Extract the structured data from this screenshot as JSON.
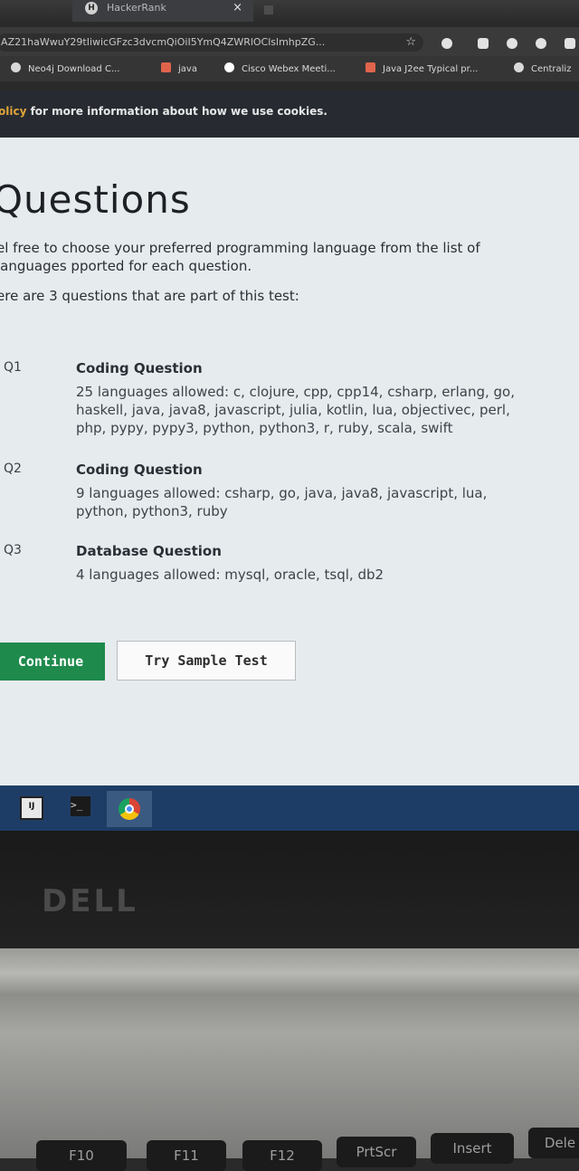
{
  "browser": {
    "tab_title": "HackerRank",
    "tab_favicon_letter": "H",
    "tab_close": "×",
    "url": "iAZ21haWwuY29tIiwicGFzc3dvcmQiOiI5YmQ4ZWRlOClslmhpZG...",
    "bookmarks": [
      {
        "label": "Neo4j Download C...",
        "icon": "neo4j-icon",
        "color": "#d9d9d9"
      },
      {
        "label": "java",
        "icon": "folder-icon",
        "color": "#e0644c"
      },
      {
        "label": "Cisco Webex Meeti...",
        "icon": "webex-icon",
        "color": "#ffffff"
      },
      {
        "label": "Java J2ee Typical pr...",
        "icon": "bookmark-icon",
        "color": "#e0644c"
      },
      {
        "label": "Centraliz",
        "icon": "globe-icon",
        "color": "#d9d9d9"
      }
    ]
  },
  "cookie_bar": {
    "link": "olicy",
    "text": " for more information about how we use cookies."
  },
  "page": {
    "heading": "Questions",
    "intro": "el free to choose your preferred programming language from the list of languages pported for each question.",
    "count_text": "ere are 3 questions that are part of this test:",
    "questions": [
      {
        "number": "Q1",
        "type": "Coding Question",
        "languages": "25 languages allowed: c, clojure, cpp, cpp14, csharp, erlang, go, haskell, java, java8, javascript, julia, kotlin, lua, objectivec, perl, php, pypy, pypy3, python, python3, r, ruby, scala, swift"
      },
      {
        "number": "Q2",
        "type": "Coding Question",
        "languages": "9 languages allowed: csharp, go, java, java8, javascript, lua, python, python3, ruby"
      },
      {
        "number": "Q3",
        "type": "Database Question",
        "languages": "4 languages allowed: mysql, oracle, tsql, db2"
      }
    ],
    "continue_label": "Continue",
    "sample_label": "Try Sample Test"
  },
  "taskbar": {
    "apps": [
      "intellij-icon",
      "terminal-icon",
      "chrome-icon"
    ],
    "intellij_text": "IJ",
    "terminal_text": ">_"
  },
  "laptop": {
    "brand": "DELL",
    "keys": [
      "F10",
      "F11",
      "F12",
      "PrtScr",
      "Insert",
      "Dele"
    ]
  },
  "colors": {
    "accent_green": "#1e8a4c",
    "cookie_link": "#e0a43a",
    "taskbar": "#1e3d66"
  }
}
